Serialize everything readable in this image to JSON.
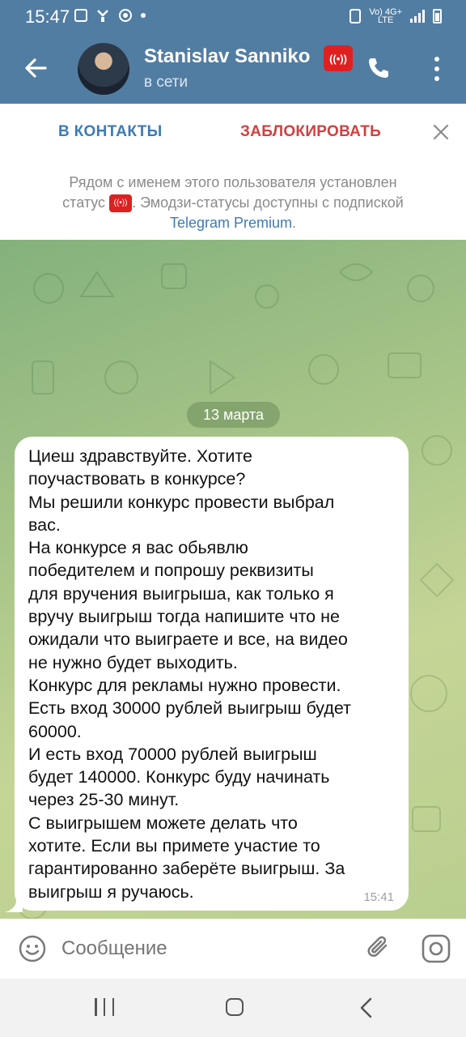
{
  "status_bar": {
    "time": "15:47",
    "network_label": "Vo) 4G+",
    "network_sub": "LTE"
  },
  "header": {
    "contact_name": "Stanislav Sanniko",
    "presence": "в сети",
    "status_emoji": "live-broadcast-badge",
    "colors": {
      "bar": "#527da3",
      "badge": "#e02020"
    }
  },
  "actions": {
    "add_contact": "В КОНТАКТЫ",
    "block": "ЗАБЛОКИРОВАТЬ"
  },
  "notice": {
    "line1": "Рядом с именем этого пользователя установлен",
    "line2_prefix": "статус ",
    "line2_suffix": ". Эмодзи-статусы доступны с подпиской",
    "link": "Telegram Premium",
    "link_suffix": "."
  },
  "chat": {
    "date": "13 марта",
    "message": {
      "text": "Циеш здравствуйте. Хотите\nпоучаствовать в конкурсе?\nМы решили конкурс провести выбрал\nвас.\nНа конкурсе я вас обьявлю\nпобедителем и попрошу реквизиты\nдля вручения выигрыша, как только я\nвручу выигрыш тогда напишите что не\nожидали что выиграете и все, на видео\nне нужно будет выходить.\nКонкурс для рекламы нужно провести.\nЕсть вход 30000 рублей выигрыш будет\n60000.\nИ есть вход 70000 рублей выигрыш\nбудет 140000. Конкурс буду начинать\nчерез 25-30 минут.\nС выигрышем можете делать что\nхотите. Если вы примете участие то\nгарантированно заберёте выигрыш. За\nвыигрыш я ручаюсь.",
      "time": "15:41"
    }
  },
  "composer": {
    "placeholder": "Сообщение"
  }
}
